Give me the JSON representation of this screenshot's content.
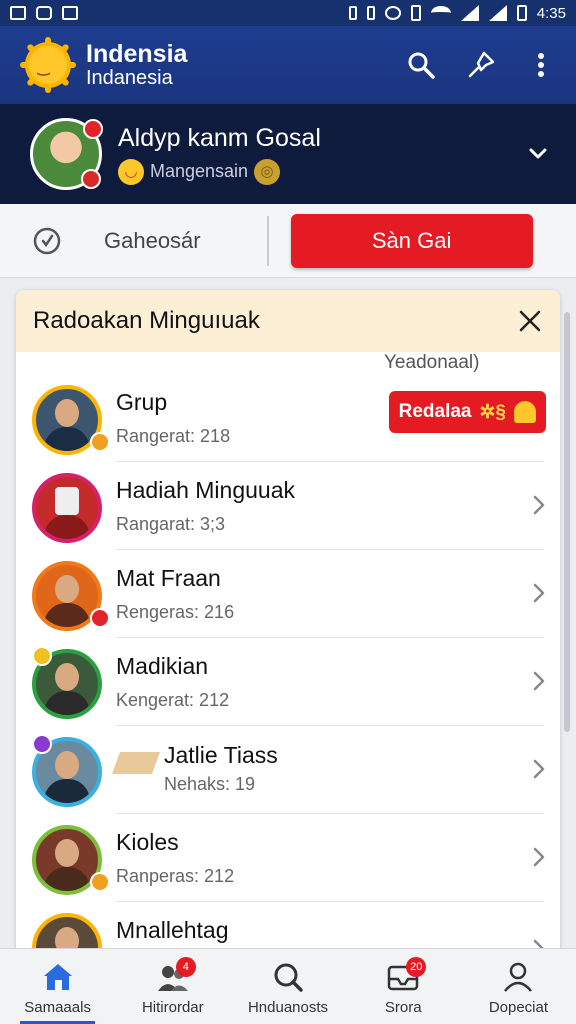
{
  "status_bar": {
    "time": "4:35"
  },
  "app_bar": {
    "title": "Indensia",
    "subtitle": "Indanesia",
    "icons": [
      "search-icon",
      "pin-icon",
      "more-vert-icon"
    ]
  },
  "profile": {
    "name": "Aldyp kanm Gosal",
    "status": "Mangensain"
  },
  "action_strip": {
    "mode_label": "Gaheosár",
    "primary_button": "Sàn Gai"
  },
  "card": {
    "title": "Radoakan Minguıuak",
    "note": "Yeadonaal)",
    "rows": [
      {
        "name": "Grup",
        "meta": "Rangerat: 218",
        "action": "Redalaa",
        "action_icon": "bell-icon"
      },
      {
        "name": "Hadiah Minguuak",
        "meta": "Rangarat: 3;3"
      },
      {
        "name": "Mat Fraan",
        "meta": "Rengeras: 216"
      },
      {
        "name": "Madikian",
        "meta": "Kengerat: 212"
      },
      {
        "name": "Jatlie Tiass",
        "meta": "Nehaks: 19"
      },
      {
        "name": "Kioles",
        "meta": "Ranperas: 212"
      },
      {
        "name": "Mnallehtag",
        "meta": ""
      }
    ]
  },
  "bottom_nav": {
    "tabs": [
      {
        "label": "Samaaals",
        "icon": "home-icon",
        "active": true
      },
      {
        "label": "Hitirordar",
        "icon": "people-icon",
        "badge": "4"
      },
      {
        "label": "Hnduanosts",
        "icon": "search-icon"
      },
      {
        "label": "Srora",
        "icon": "inbox-icon",
        "badge": "20"
      },
      {
        "label": "Dopeciat",
        "icon": "person-icon"
      }
    ]
  },
  "colors": {
    "app_bar": "#1e3d8f",
    "profile_bg": "#0f1b3d",
    "accent_red": "#e41b23",
    "card_header": "#fcefd6",
    "active_tab": "#1e5bd8"
  }
}
